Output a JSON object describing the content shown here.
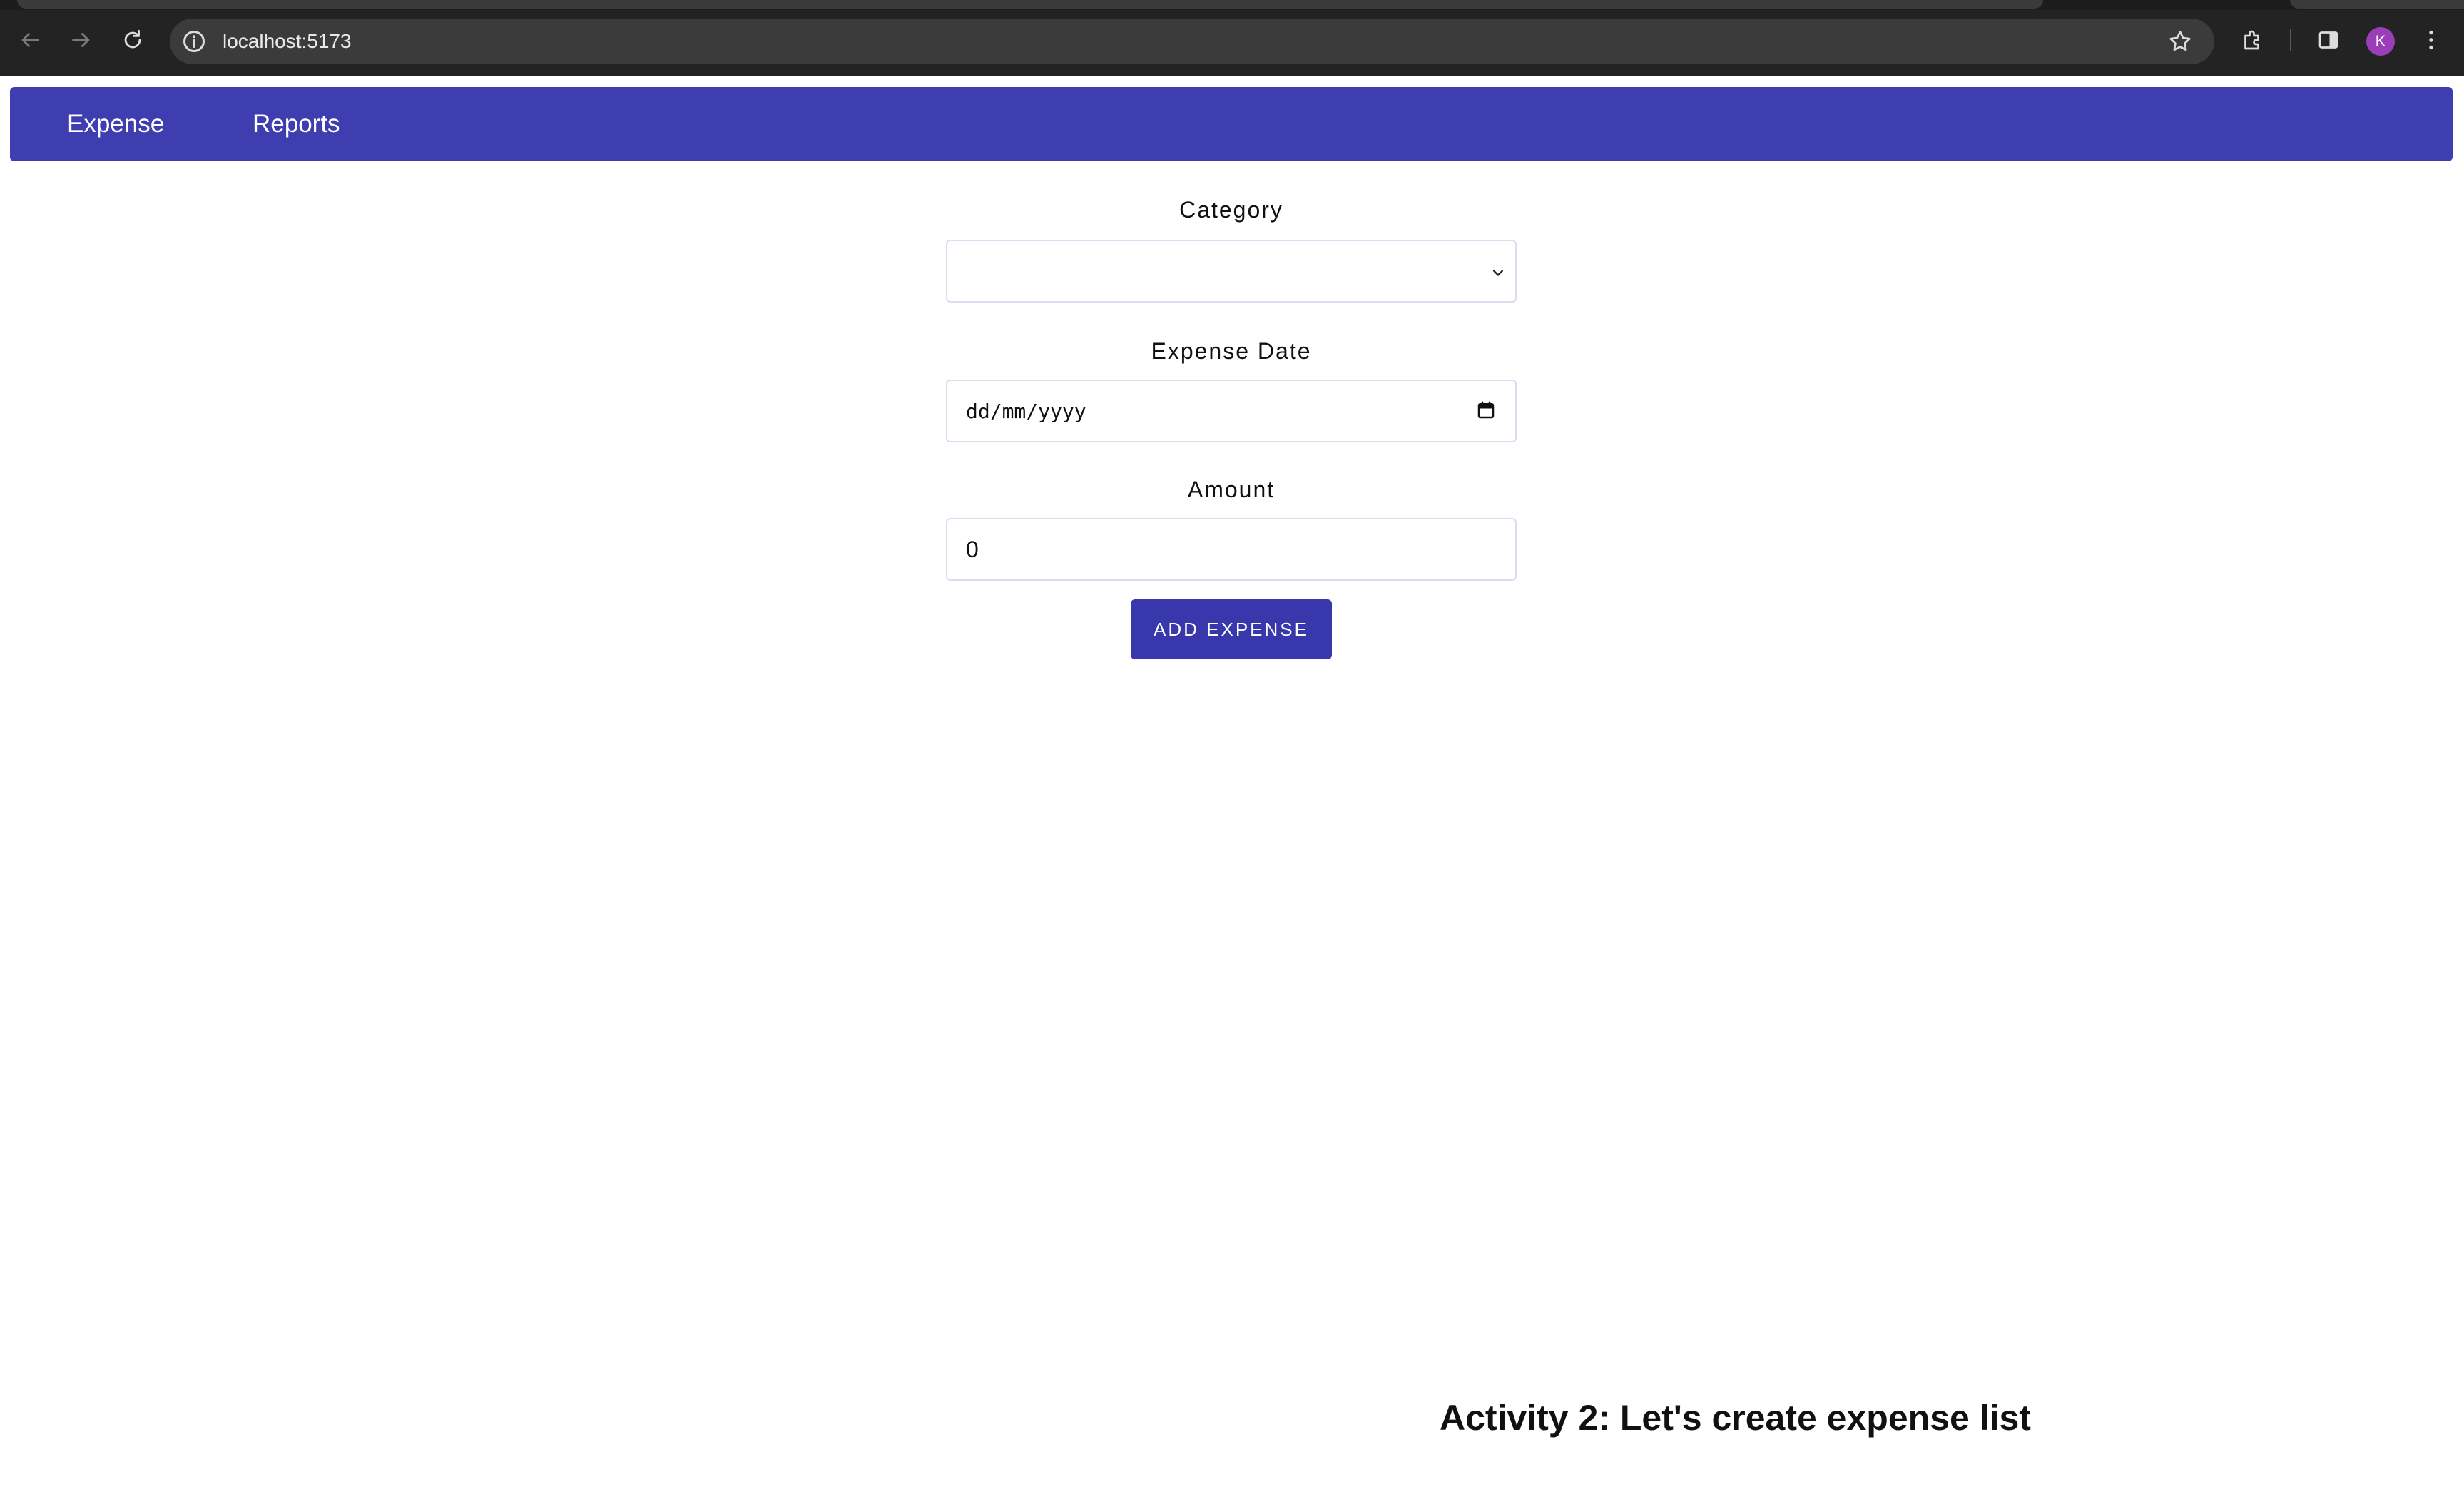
{
  "browser": {
    "url": "localhost:5173",
    "avatar_letter": "K"
  },
  "appbar": {
    "nav": [
      {
        "label": "Expense"
      },
      {
        "label": "Reports"
      }
    ]
  },
  "form": {
    "category": {
      "label": "Category",
      "value": ""
    },
    "expense_date": {
      "label": "Expense Date",
      "placeholder": "dd/mm/yyyy"
    },
    "amount": {
      "label": "Amount",
      "value": "0"
    },
    "submit_label": "ADD EXPENSE"
  },
  "caption": "Activity 2: Let's create expense list",
  "colors": {
    "appbar": "#3e3eb0",
    "button": "#3838ac",
    "avatar": "#9b3fb8"
  }
}
